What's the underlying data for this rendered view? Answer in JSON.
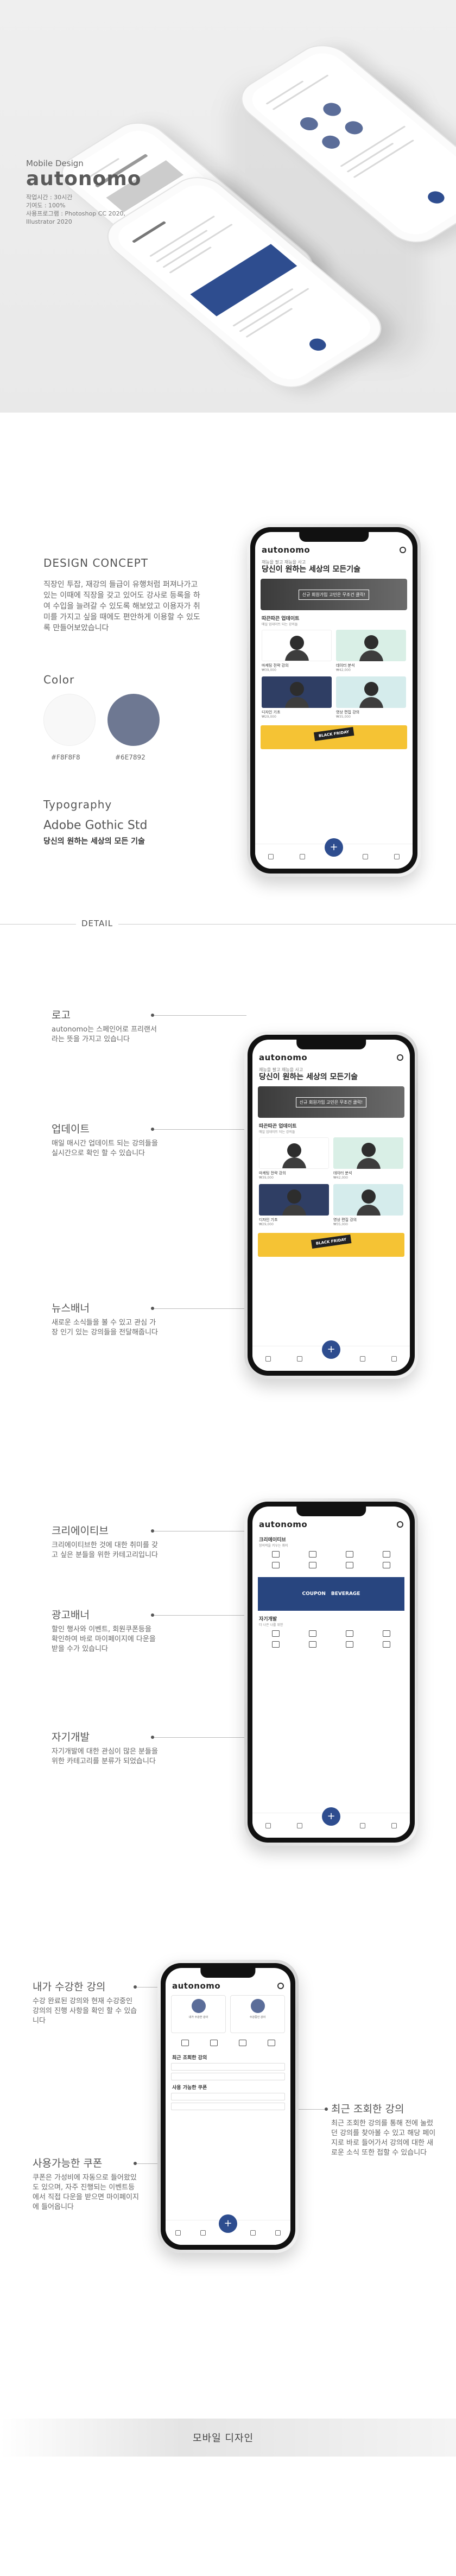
{
  "hero": {
    "subtitle": "Mobile Design",
    "brand": "autonomo",
    "meta_lines": [
      "작업시간 : 30시간",
      "기여도 : 100%",
      "사용프로그램 : Photoshop CC 2020,",
      "Illustrator 2020"
    ]
  },
  "concept": {
    "title": "DESIGN CONCEPT",
    "body": "직장인 투잡, 재강의 들급이 유행처럼 퍼져나가고 있는 이때에 직장을 갖고 있어도 강사로 등록을 하여 수입을 늘려갈 수 있도록 해보았고 이용자가 취미를 가지고 싶을 때에도 편안하게 이용할 수 있도록 만들어보았습니다"
  },
  "color": {
    "title": "Color",
    "swatches": [
      {
        "hex": "#F8F8F8",
        "label": "#F8F8F8"
      },
      {
        "hex": "#6E7892",
        "label": "#6E7892"
      }
    ]
  },
  "typography": {
    "title": "Typography",
    "font_name": "Adobe Gothic Std",
    "sample": "당신의 원하는 세상의 모든 기술"
  },
  "detail": {
    "title": "DETAIL"
  },
  "app": {
    "logo": "autonomo",
    "headline_sub": "재능을 팔고 재능을 사고",
    "headline": "당신이 원하는 세상의 모든기술",
    "banner_text": "신규 회원가입 고민은 무조건 클릭!",
    "section_title": "따끈따끈 업데이트",
    "section_sub": "매일 업데이트 되는 강의들",
    "cards": [
      {
        "name": "마케팅 전략 강의",
        "price": "₩39,000",
        "color": "#ffffff"
      },
      {
        "name": "데이터 분석",
        "price": "₩42,000",
        "color": "#d9efe6"
      },
      {
        "name": "디자인 기초",
        "price": "₩29,000",
        "color": "#2f3e64"
      },
      {
        "name": "영상 편집 강의",
        "price": "₩35,000",
        "color": "#d5ecec"
      }
    ],
    "news_tag": "BLACK FRIDAY",
    "fab": "+"
  },
  "detail1": [
    {
      "title": "로고",
      "desc": "autonomo는 스페인어로 프리랜서 라는 뜻을 가지고 있습니다"
    },
    {
      "title": "업데이트",
      "desc": "매일 매시간 업데이트 되는 강의들을 실시간으로 확인 할 수 있습니다"
    },
    {
      "title": "뉴스배너",
      "desc": "새로운 소식들을 볼 수 있고 관심 가장 인기 있는 강의들을 전달해줍니다"
    }
  ],
  "detail2": [
    {
      "title": "크리에이티브",
      "desc": "크리에이티브한 것에 대한 취미를 갖고 싶은 분들을 위한 카테고리입니다"
    },
    {
      "title": "광고배너",
      "desc": "할인 행사와 이벤트, 회원쿠폰등을 확인하여 바로 마이페이지에 다운을 받을 수가 있습니다"
    },
    {
      "title": "자기개발",
      "desc": "자기개발에 대한 관심이 많은 분들을 위한 카테고리를 분류가 되었습니다"
    }
  ],
  "app2": {
    "creative_title": "크리에이티브",
    "creative_sub": "창의력을 키우는 취미",
    "coupon_left": "COUPON",
    "coupon_right": "BEVERAGE",
    "self_title": "자기개발",
    "self_sub": "더 나은 나를 위한"
  },
  "detail3": {
    "left": [
      {
        "title": "내가 수강한 강의",
        "desc": "수강 완료된 강의와 현재 수강중인 강의의 진행 사항을 확인 할 수 있습니다"
      },
      {
        "title": "사용가능한 쿠폰",
        "desc": "쿠폰은 가성비에 자동으로 들어왔있도 있으며, 자주 진행되는 이벤트등에서 직접 다운을 받으면 마이페이지에 들어옵니다"
      }
    ],
    "right": [
      {
        "title": "최근 조회한 강의",
        "desc": "최근 조회한 강의를 통해 전에 눌렀던 강의를 찾아볼 수 있고 해당 페이지로 바로 들어가서 강의에 대한 새로운 소식 또한 접할 수 있습니다"
      }
    ]
  },
  "app3": {
    "logo": "autonomo",
    "class_titles": [
      "내가 수강한 강의",
      "수강중인 강의"
    ],
    "recent_title": "최근 조회한 강의",
    "coupon_title": "사용 가능한 쿠폰"
  },
  "closing": {
    "title": "모바일 디자인"
  }
}
